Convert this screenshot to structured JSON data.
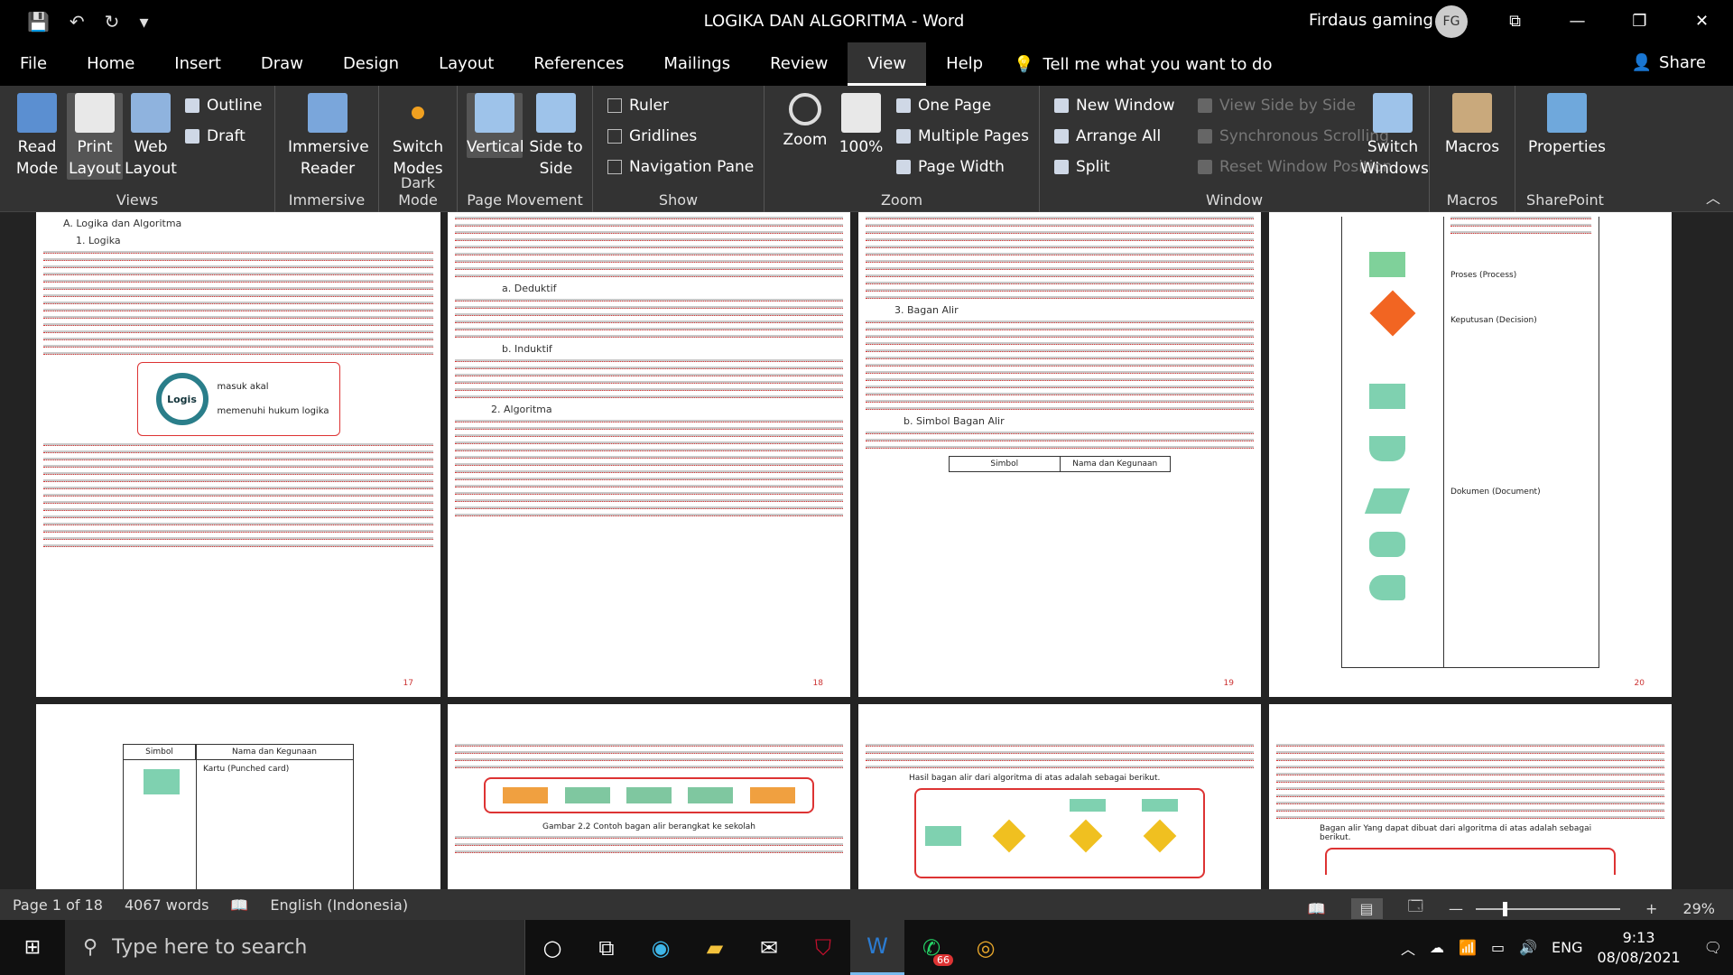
{
  "titlebar": {
    "doc_title": "LOGIKA DAN ALGORITMA  -  Word",
    "user": "Firdaus gaming",
    "avatar_initials": "FG"
  },
  "menu": {
    "items": [
      "File",
      "Home",
      "Insert",
      "Draw",
      "Design",
      "Layout",
      "References",
      "Mailings",
      "Review",
      "View",
      "Help"
    ],
    "active": "View",
    "tell_me": "Tell me what you want to do",
    "share": "Share"
  },
  "ribbon": {
    "views": {
      "read_mode": "Read Mode",
      "print_layout": "Print Layout",
      "web_layout": "Web Layout",
      "outline": "Outline",
      "draft": "Draft",
      "label": "Views"
    },
    "immersive": {
      "reader": "Immersive Reader",
      "label": "Immersive"
    },
    "darkmode": {
      "switch": "Switch Modes",
      "label": "Dark Mode"
    },
    "movement": {
      "vertical": "Vertical",
      "side": "Side to Side",
      "label": "Page Movement"
    },
    "show": {
      "ruler": "Ruler",
      "gridlines": "Gridlines",
      "nav": "Navigation Pane",
      "label": "Show"
    },
    "zoom": {
      "zoom": "Zoom",
      "hundred": "100%",
      "one": "One Page",
      "multi": "Multiple Pages",
      "width": "Page Width",
      "label": "Zoom"
    },
    "window": {
      "new": "New Window",
      "arrange": "Arrange All",
      "split": "Split",
      "side": "View Side by Side",
      "sync": "Synchronous Scrolling",
      "reset": "Reset Window Position",
      "switch": "Switch Windows",
      "label": "Window"
    },
    "macros": {
      "macros": "Macros",
      "label": "Macros"
    },
    "sharepoint": {
      "props": "Properties",
      "label": "SharePoint"
    }
  },
  "pages": {
    "p17_heading": "A. Logika dan Algoritma",
    "p17_sub": "1. Logika",
    "p17_logo": "Logis",
    "p17_logo_a": "masuk akal",
    "p17_logo_b": "memenuhi hukum logika",
    "p17_num": "17",
    "p18_a": "a.  Deduktif",
    "p18_b": "b.  Induktif",
    "p18_c": "2. Algoritma",
    "p18_num": "18",
    "p19_a": "3. Bagan Alir",
    "p19_b": "b. Simbol Bagan Alir",
    "p19_tbl_a": "Simbol",
    "p19_tbl_b": "Nama dan Kegunaan",
    "p19_num": "19",
    "p20_a": "Proses (Process)",
    "p20_b": "Keputusan (Decision)",
    "p20_c": "Dokumen (Document)",
    "p20_num": "20",
    "p21_a": "Simbol",
    "p21_b": "Nama dan Kegunaan",
    "p21_c": "Kartu (Punched card)",
    "p22_a": "Gambar 2.2 Contoh bagan alir berangkat ke sekolah",
    "p23_a": "Hasil bagan alir dari algoritma di atas adalah sebagai berikut.",
    "p24_a": "Bagan alir Yang dapat dibuat dari algoritma di atas adalah sebagai berikut."
  },
  "status": {
    "page": "Page 1 of 18",
    "words": "4067 words",
    "language": "English (Indonesia)",
    "zoom": "29%"
  },
  "taskbar": {
    "search_placeholder": "Type here to search",
    "lang": "ENG",
    "time": "9:13",
    "date": "08/08/2021",
    "wa_badge": "66"
  }
}
